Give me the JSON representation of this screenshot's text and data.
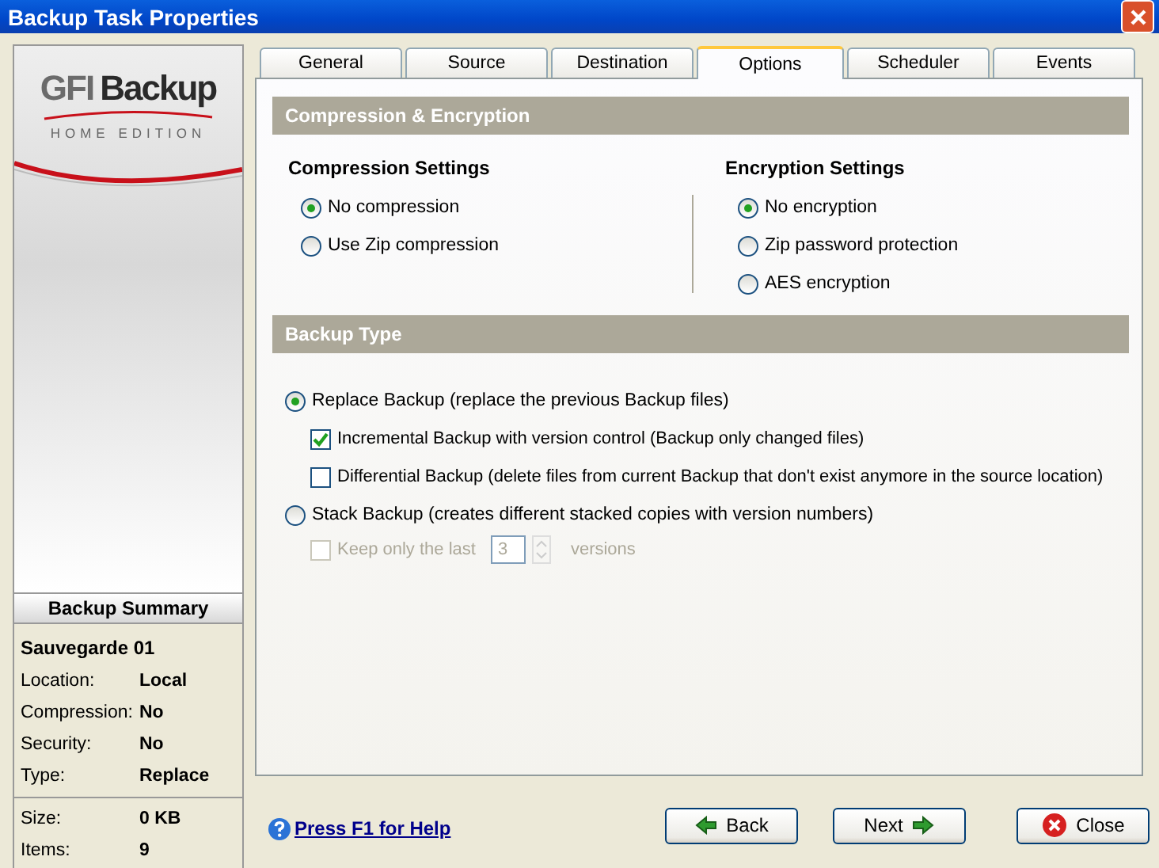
{
  "window": {
    "title": "Backup Task Properties"
  },
  "logo": {
    "brand_prefix": "GFI",
    "brand_name": "Backup",
    "edition": "HOME EDITION"
  },
  "summary": {
    "title": "Backup Summary",
    "name": "Sauvegarde 01",
    "rows": [
      {
        "label": "Location:",
        "value": "Local"
      },
      {
        "label": "Compression:",
        "value": "No"
      },
      {
        "label": "Security:",
        "value": "No"
      },
      {
        "label": "Type:",
        "value": "Replace"
      }
    ],
    "totals": [
      {
        "label": "Size:",
        "value": "0 KB"
      },
      {
        "label": "Items:",
        "value": "9"
      }
    ]
  },
  "tabs": [
    {
      "label": "General",
      "selected": false
    },
    {
      "label": "Source",
      "selected": false
    },
    {
      "label": "Destination",
      "selected": false
    },
    {
      "label": "Options",
      "selected": true
    },
    {
      "label": "Scheduler",
      "selected": false
    },
    {
      "label": "Events",
      "selected": false
    }
  ],
  "compression_encryption": {
    "title": "Compression & Encryption",
    "groups": [
      {
        "title": "Compression Settings",
        "options": [
          {
            "label": "No compression",
            "selected": true
          },
          {
            "label": "Use Zip compression",
            "selected": false
          }
        ]
      },
      {
        "title": "Encryption Settings",
        "options": [
          {
            "label": "No encryption",
            "selected": true
          },
          {
            "label": "Zip password protection",
            "selected": false
          },
          {
            "label": "AES encryption",
            "selected": false
          }
        ]
      }
    ]
  },
  "backup_type": {
    "title": "Backup Type",
    "options": [
      {
        "label": "Replace Backup (replace the previous Backup files)",
        "selected": true,
        "sub_options": [
          {
            "label": "Incremental Backup with version control (Backup only changed files)",
            "checked": true
          },
          {
            "label": "Differential Backup (delete files from current Backup that don't exist anymore in the source location)",
            "checked": false
          }
        ]
      },
      {
        "label": "Stack Backup (creates different stacked copies with version numbers)",
        "selected": false
      }
    ],
    "keep_last": {
      "label": "Keep only the last",
      "value": "3",
      "suffix": "versions",
      "checked": false,
      "disabled": true
    }
  },
  "help_link": "Press F1 for Help",
  "buttons": [
    {
      "label": "Back",
      "kind": "back"
    },
    {
      "label": "Next",
      "kind": "next"
    },
    {
      "label": "Close",
      "kind": "close"
    }
  ]
}
